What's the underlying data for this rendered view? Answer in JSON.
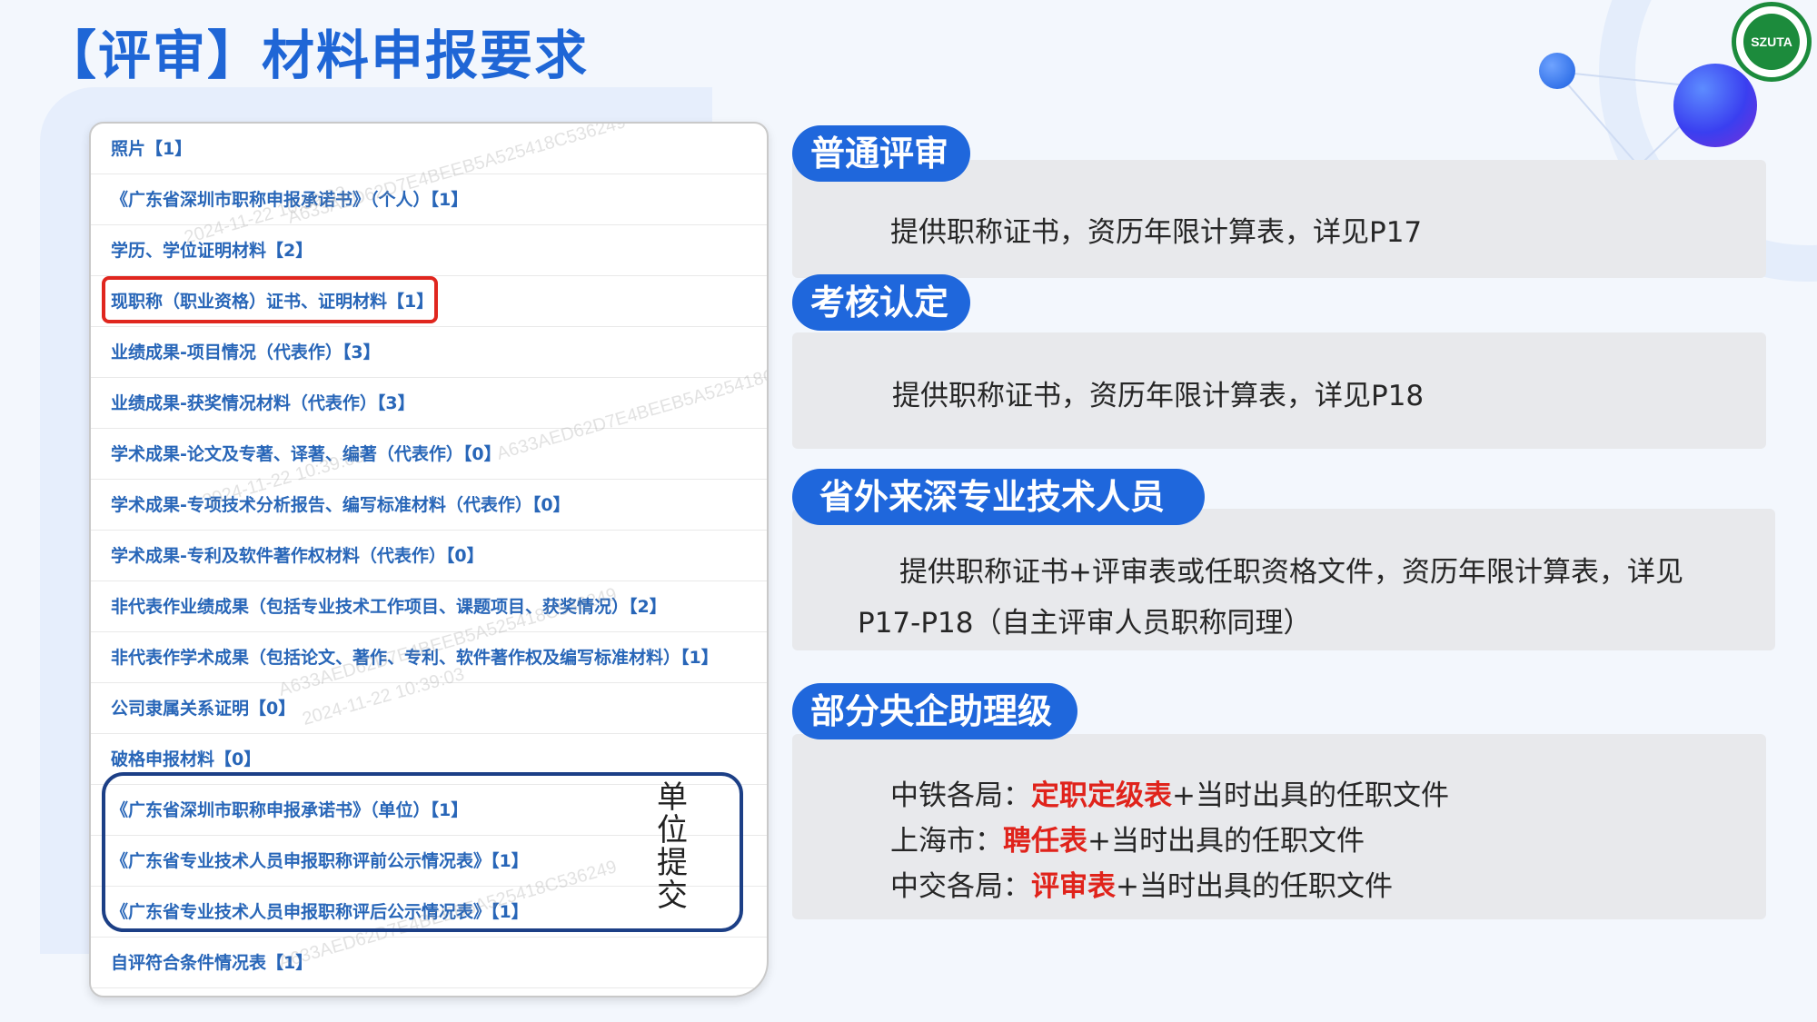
{
  "title": "【评审】材料申报要求",
  "logo_text": "SZUTA",
  "doc_items": [
    "照片【1】",
    "《广东省深圳市职称申报承诺书》（个人）【1】",
    "学历、学位证明材料【2】",
    "现职称（职业资格）证书、证明材料【1】",
    "业绩成果-项目情况（代表作）【3】",
    "业绩成果-获奖情况材料（代表作）【3】",
    "学术成果-论文及专著、译著、编著（代表作）【0】",
    "学术成果-专项技术分析报告、编写标准材料（代表作）【0】",
    "学术成果-专利及软件著作权材料（代表作）【0】",
    "非代表作业绩成果（包括专业技术工作项目、课题项目、获奖情况）【2】",
    "非代表作学术成果（包括论文、著作、专利、软件著作权及编写标准材料）【1】",
    "公司隶属关系证明【0】",
    "破格申报材料【0】",
    "《广东省深圳市职称申报承诺书》（单位）【1】",
    "《广东省专业技术人员申报职称评前公示情况表》【1】",
    "《广东省专业技术人员申报职称评后公示情况表》【1】",
    "自评符合条件情况表【1】"
  ],
  "watermarks": [
    "A633AED62D7E4BEEB5A525418C536249",
    "2024-11-22 10:39:03"
  ],
  "unit_label": "单位提交",
  "sections": {
    "normal": {
      "label": "普通评审",
      "text": "提供职称证书，资历年限计算表，详见P17"
    },
    "assess": {
      "label": "考核认定",
      "text": "提供职称证书，资历年限计算表，详见P18"
    },
    "outside": {
      "label": "省外来深专业技术人员",
      "text_line1": "提供职称证书+评审表或任职资格文件，资历年限计算表，详见",
      "text_line2": "P17-P18（自主评审人员职称同理）"
    },
    "soe": {
      "label": "部分央企助理级",
      "lines": [
        {
          "prefix": "中铁各局：",
          "highlight": "定职定级表",
          "suffix": "+当时出具的任职文件"
        },
        {
          "prefix": "上海市：",
          "highlight": "聘任表",
          "suffix": "+当时出具的任职文件"
        },
        {
          "prefix": "中交各局：",
          "highlight": "评审表",
          "suffix": "+当时出具的任职文件"
        }
      ]
    }
  },
  "colors": {
    "title": "#1f66d6",
    "pill": "#1f67dc",
    "doc_text": "#2866b8",
    "highlight_red": "#e0231b",
    "red_box": "#e0261e",
    "blue_box": "#1c3f86"
  }
}
